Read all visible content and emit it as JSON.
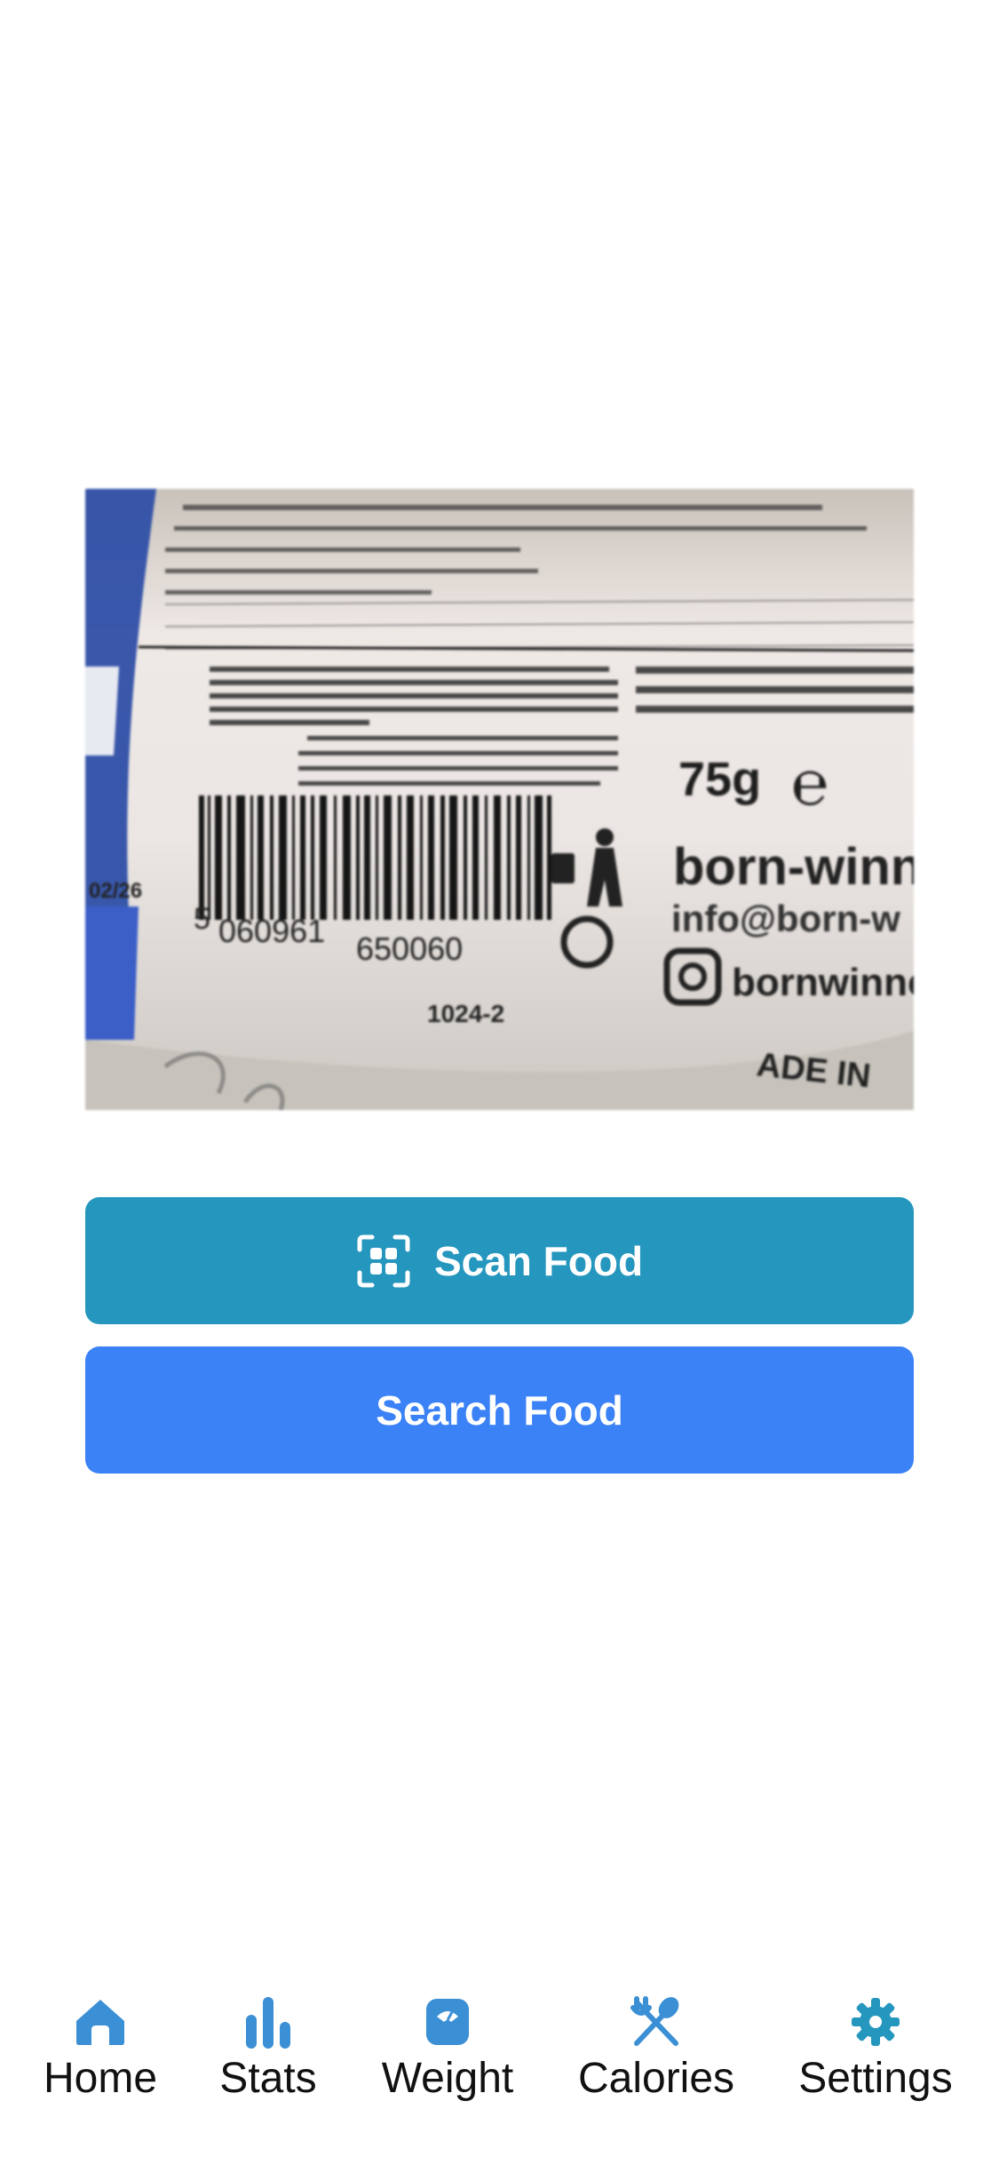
{
  "camera": {
    "barcode_left": "5",
    "barcode_digits_1": "060961",
    "barcode_digits_2": "650060",
    "batch_code": "1024-2",
    "weight_text": "75g",
    "brand_text": "born-winn",
    "email_text": "info@born-w",
    "instagram_text": "bornwinne",
    "date_text": "02/26",
    "made_in_text": "ADE IN"
  },
  "actions": {
    "scan_label": "Scan Food",
    "search_label": "Search Food"
  },
  "tabs": [
    {
      "label": "Home",
      "icon": "home-icon"
    },
    {
      "label": "Stats",
      "icon": "bar-chart-icon"
    },
    {
      "label": "Weight",
      "icon": "scale-icon"
    },
    {
      "label": "Calories",
      "icon": "utensils-icon"
    },
    {
      "label": "Settings",
      "icon": "gear-icon"
    }
  ],
  "colors": {
    "scan_button": "#2596be",
    "search_button": "#3b82f6",
    "tab_icon": "#3b8fd4",
    "tab_icon_settings": "#2596be"
  }
}
